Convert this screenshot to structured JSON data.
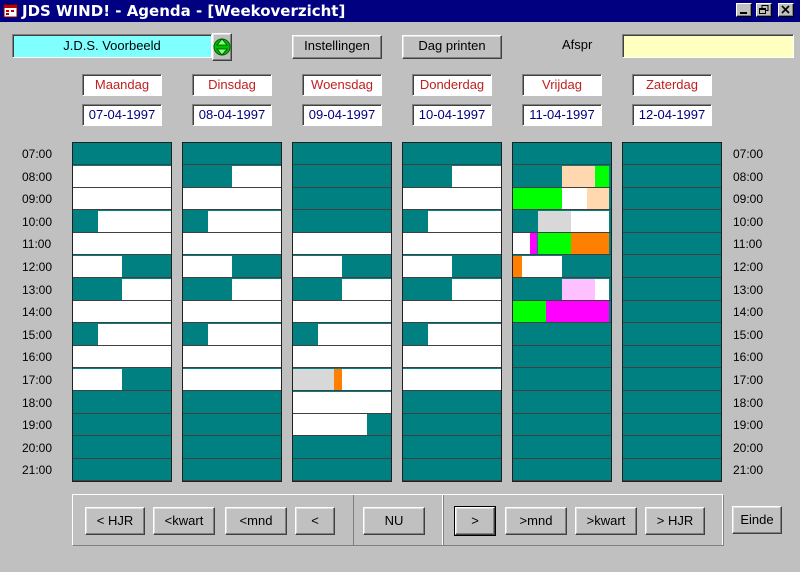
{
  "window": {
    "title": "JDS WIND! - Agenda - [Weekoverzicht]",
    "app_icon": "jds-app-icon",
    "controls": [
      "minimize-icon",
      "restore-icon",
      "close-icon"
    ]
  },
  "toolbar": {
    "user_value": "J.D.S. Voorbeeld",
    "settings_label": "Instellingen",
    "print_label": "Dag printen",
    "afspr_label": "Afspr",
    "afspr_value": ""
  },
  "days": [
    {
      "name": "Maandag",
      "date": "07-04-1997"
    },
    {
      "name": "Dinsdag",
      "date": "08-04-1997"
    },
    {
      "name": "Woensdag",
      "date": "09-04-1997"
    },
    {
      "name": "Donderdag",
      "date": "10-04-1997"
    },
    {
      "name": "Vrijdag",
      "date": "11-04-1997"
    },
    {
      "name": "Zaterdag",
      "date": "12-04-1997"
    }
  ],
  "hours": [
    "07:00",
    "08:00",
    "09:00",
    "10:00",
    "11:00",
    "12:00",
    "13:00",
    "14:00",
    "15:00",
    "16:00",
    "17:00",
    "18:00",
    "19:00",
    "20:00",
    "21:00"
  ],
  "colors": {
    "busy": "#008080",
    "free": "#ffffff",
    "green": "#00ff00",
    "peach": "#ffd8b0",
    "grey": "#d8d8d8",
    "orange": "#ff8000",
    "magenta": "#ff00ff",
    "pink": "#ffc0ff"
  },
  "schedule": [
    [
      [],
      [
        [
          "free",
          0,
          1
        ]
      ],
      [
        [
          "free",
          0,
          1
        ]
      ],
      [
        [
          "free",
          0.25,
          1
        ]
      ],
      [
        [
          "free",
          0,
          1
        ]
      ],
      [
        [
          "free",
          0,
          0.5
        ]
      ],
      [
        [
          "free",
          0.5,
          1
        ]
      ],
      [
        [
          "free",
          0,
          1
        ]
      ],
      [
        [
          "free",
          0.25,
          1
        ]
      ],
      [
        [
          "free",
          0,
          1
        ]
      ],
      [
        [
          "free",
          0,
          0.5
        ]
      ],
      [],
      [],
      [],
      []
    ],
    [
      [],
      [
        [
          "free",
          0.5,
          1
        ]
      ],
      [
        [
          "free",
          0,
          1
        ]
      ],
      [
        [
          "free",
          0.25,
          1
        ]
      ],
      [
        [
          "free",
          0,
          1
        ]
      ],
      [
        [
          "free",
          0,
          0.5
        ]
      ],
      [
        [
          "free",
          0.5,
          1
        ]
      ],
      [
        [
          "free",
          0,
          1
        ]
      ],
      [
        [
          "free",
          0.25,
          1
        ]
      ],
      [
        [
          "free",
          0,
          1
        ]
      ],
      [
        [
          "free",
          0,
          1
        ]
      ],
      [],
      [],
      [],
      []
    ],
    [
      [],
      [],
      [],
      [],
      [
        [
          "free",
          0,
          1
        ]
      ],
      [
        [
          "free",
          0,
          0.5
        ]
      ],
      [
        [
          "free",
          0.5,
          1
        ]
      ],
      [
        [
          "free",
          0,
          1
        ]
      ],
      [
        [
          "free",
          0.25,
          1
        ]
      ],
      [
        [
          "free",
          0,
          1
        ]
      ],
      [
        [
          "grey",
          0,
          0.42
        ],
        [
          "orange",
          0.42,
          0.5
        ],
        [
          "free",
          0.5,
          1
        ]
      ],
      [
        [
          "free",
          0,
          1
        ]
      ],
      [
        [
          "free",
          0,
          0.75
        ]
      ],
      [],
      []
    ],
    [
      [],
      [
        [
          "free",
          0.5,
          1
        ]
      ],
      [
        [
          "free",
          0,
          1
        ]
      ],
      [
        [
          "free",
          0.25,
          1
        ]
      ],
      [
        [
          "free",
          0,
          1
        ]
      ],
      [
        [
          "free",
          0,
          0.5
        ]
      ],
      [
        [
          "free",
          0.5,
          1
        ]
      ],
      [
        [
          "free",
          0,
          1
        ]
      ],
      [
        [
          "free",
          0.25,
          1
        ]
      ],
      [
        [
          "free",
          0,
          1
        ]
      ],
      [
        [
          "free",
          0,
          1
        ]
      ],
      [],
      [],
      [],
      []
    ],
    [
      [],
      [
        [
          "peach",
          0.5,
          0.84
        ],
        [
          "green",
          0.84,
          0.98
        ]
      ],
      [
        [
          "green",
          0,
          0.5
        ],
        [
          "free",
          0.5,
          0.75
        ],
        [
          "peach",
          0.75,
          0.98
        ]
      ],
      [
        [
          "grey",
          0.25,
          0.59
        ],
        [
          "free",
          0.59,
          0.98
        ]
      ],
      [
        [
          "free",
          0,
          0.17
        ],
        [
          "magenta",
          0.17,
          0.25
        ],
        [
          "green",
          0.25,
          0.59
        ],
        [
          "orange",
          0.59,
          0.98
        ]
      ],
      [
        [
          "orange",
          0,
          0.09
        ],
        [
          "free",
          0.09,
          0.5
        ]
      ],
      [
        [
          "pink",
          0.5,
          0.84
        ],
        [
          "free",
          0.84,
          0.98
        ]
      ],
      [
        [
          "green",
          0,
          0.34
        ],
        [
          "magenta",
          0.34,
          0.98
        ]
      ],
      [],
      [],
      [],
      [],
      [],
      [],
      []
    ],
    [
      [],
      [],
      [],
      [],
      [],
      [],
      [],
      [],
      [],
      [],
      [],
      [],
      [],
      [],
      []
    ]
  ],
  "nav": {
    "back": [
      "< HJR",
      "<kwart",
      "<mnd",
      "<"
    ],
    "now": "NU",
    "forward": [
      ">",
      ">mnd",
      ">kwart",
      "> HJR"
    ],
    "exit": "Einde"
  }
}
